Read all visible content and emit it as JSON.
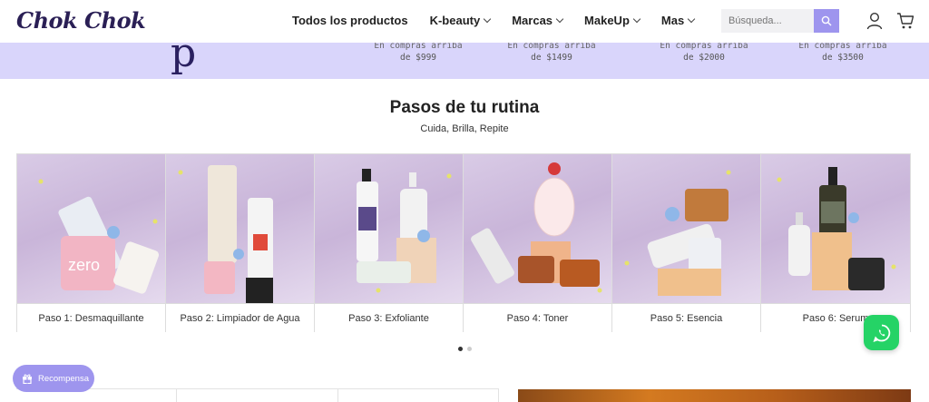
{
  "header": {
    "logo": "Chok Chok",
    "nav": [
      {
        "label": "Todos los productos",
        "has_dropdown": false
      },
      {
        "label": "K-beauty",
        "has_dropdown": true
      },
      {
        "label": "Marcas",
        "has_dropdown": true
      },
      {
        "label": "MakeUp",
        "has_dropdown": true
      },
      {
        "label": "Mas",
        "has_dropdown": true
      }
    ],
    "search_placeholder": "Búsqueda..."
  },
  "banner": {
    "tiers": [
      {
        "line1": "En compras arriba",
        "line2": "de $999"
      },
      {
        "line1": "En compras arriba",
        "line2": "de $1499"
      },
      {
        "line1": "En compras arriba",
        "line2": "de $2000"
      },
      {
        "line1": "En compras arriba",
        "line2": "de $3500"
      }
    ]
  },
  "section": {
    "title": "Pasos de tu rutina",
    "subtitle": "Cuida, Brilla, Repite",
    "cards": [
      {
        "label": "Paso 1: Desmaquillante"
      },
      {
        "label": "Paso 2: Limpiador de Agua"
      },
      {
        "label": "Paso 3: Exfoliante"
      },
      {
        "label": "Paso 4: Toner"
      },
      {
        "label": "Paso 5: Esencia"
      },
      {
        "label": "Paso 6: Serum"
      }
    ],
    "pagination": {
      "pages": 2,
      "current": 1
    }
  },
  "reward": {
    "label": "Recompensa"
  },
  "colors": {
    "accent": "#9e95ee",
    "banner": "#d9d5fb",
    "brand": "#2a1f55",
    "whatsapp": "#25d366"
  }
}
